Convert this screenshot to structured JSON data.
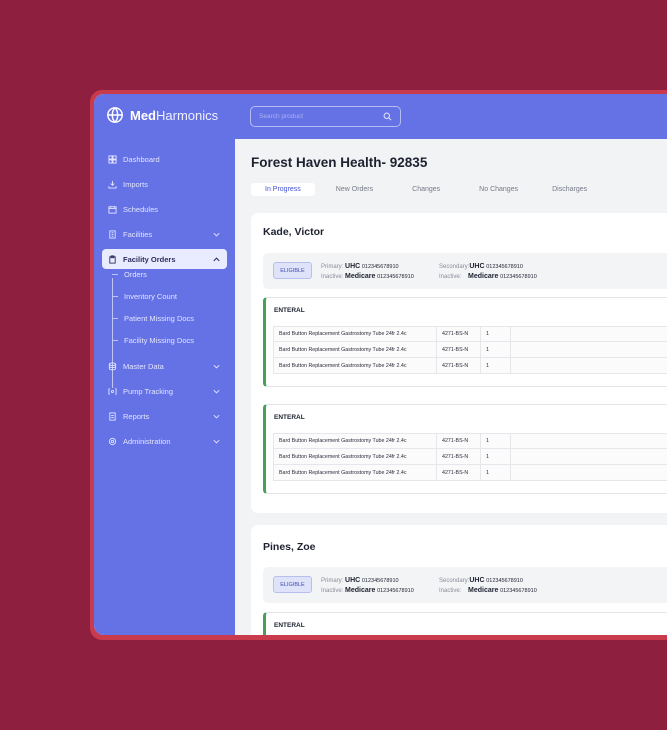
{
  "app": {
    "brand_bold": "Med",
    "brand_rest": "Harmonics"
  },
  "search": {
    "placeholder": "Search product"
  },
  "sidebar": {
    "items": [
      {
        "label": "Dashboard",
        "icon": "dashboard-icon"
      },
      {
        "label": "Imports",
        "icon": "import-icon"
      },
      {
        "label": "Schedules",
        "icon": "calendar-icon"
      },
      {
        "label": "Facilities",
        "icon": "building-icon"
      },
      {
        "label": "Facility Orders",
        "icon": "clipboard-icon",
        "active": true
      },
      {
        "label": "Master Data",
        "icon": "database-icon"
      },
      {
        "label": "Pump Tracking",
        "icon": "pump-icon"
      },
      {
        "label": "Reports",
        "icon": "report-icon"
      },
      {
        "label": "Administration",
        "icon": "gear-icon"
      }
    ],
    "sub_items": [
      "Orders",
      "Inventory Count",
      "Patient Missing Docs",
      "Facility Missing Docs"
    ]
  },
  "page": {
    "title": "Forest Haven Health- 92835",
    "tabs": [
      "In Progress",
      "New Orders",
      "Changes",
      "No Changes",
      "Discharges"
    ]
  },
  "patients": [
    {
      "name": "Kade, Victor",
      "eligibility": "ELIGIBLE",
      "primary_label": "Primary:",
      "primary_name": "UHC",
      "primary_id": "012345678910",
      "primary_inactive_label": "Inactive:",
      "primary_inactive_name": "Medicare",
      "primary_inactive_id": "012345678910",
      "secondary_label": "Secondary:",
      "secondary_name": "UHC",
      "secondary_id": "012345678910",
      "secondary_inactive_label": "Inactive:",
      "secondary_inactive_name": "Medicare",
      "secondary_inactive_id": "012345678910",
      "groups": [
        {
          "title": "ENTERAL",
          "rows": [
            {
              "desc": "Bard Button Replacement Gastrostomy Tube 24fr 2.4c",
              "code": "4271-BS-N",
              "qty": "1"
            },
            {
              "desc": "Bard Button Replacement Gastrostomy Tube 24fr 2.4c",
              "code": "4271-BS-N",
              "qty": "1"
            },
            {
              "desc": "Bard Button Replacement Gastrostomy Tube 24fr 2.4c",
              "code": "4271-BS-N",
              "qty": "1"
            }
          ]
        },
        {
          "title": "ENTERAL",
          "rows": [
            {
              "desc": "Bard Button Replacement Gastrostomy Tube 24fr 2.4c",
              "code": "4271-BS-N",
              "qty": "1"
            },
            {
              "desc": "Bard Button Replacement Gastrostomy Tube 24fr 2.4c",
              "code": "4271-BS-N",
              "qty": "1"
            },
            {
              "desc": "Bard Button Replacement Gastrostomy Tube 24fr 2.4c",
              "code": "4271-BS-N",
              "qty": "1"
            }
          ]
        }
      ]
    },
    {
      "name": "Pines, Zoe",
      "eligibility": "ELIGIBLE",
      "primary_label": "Primary:",
      "primary_name": "UHC",
      "primary_id": "012345678910",
      "primary_inactive_label": "Inactive:",
      "primary_inactive_name": "Medicare",
      "primary_inactive_id": "012345678910",
      "secondary_label": "Secondary:",
      "secondary_name": "UHC",
      "secondary_id": "012345678910",
      "secondary_inactive_label": "Inactive:",
      "secondary_inactive_name": "Medicare",
      "secondary_inactive_id": "012345678910",
      "groups": [
        {
          "title": "ENTERAL",
          "rows": []
        }
      ]
    }
  ],
  "colors": {
    "background": "#8e1f3f",
    "frame": "#c73b4c",
    "sidebar": "#6572e6",
    "accent": "#4552d6",
    "group_border": "#46a05a"
  }
}
